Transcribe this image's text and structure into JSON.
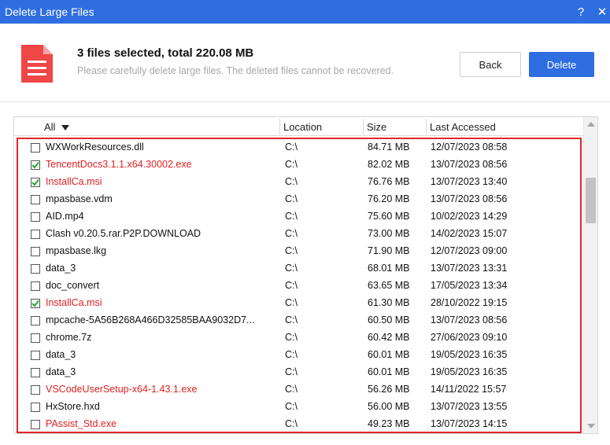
{
  "window": {
    "title": "Delete Large Files",
    "help_label": "?",
    "close_label": "✕"
  },
  "colors": {
    "accent": "#2f6ee0",
    "danger": "#e0262b",
    "file_icon": "#ef4646"
  },
  "header": {
    "summary": "3 files selected, total 220.08 MB",
    "warning": "Please carefully delete large files. The deleted files cannot be recovered.",
    "back_label": "Back",
    "delete_label": "Delete"
  },
  "table": {
    "headers": {
      "all": "All",
      "location": "Location",
      "size": "Size",
      "accessed": "Last Accessed"
    },
    "rows": [
      {
        "name": "WXWorkResources.dll",
        "location": "C:\\",
        "size": "84.71 MB",
        "accessed": "12/07/2023 08:58",
        "checked": false,
        "highlight": false
      },
      {
        "name": "TencentDocs3.1.1.x64.30002.exe",
        "location": "C:\\",
        "size": "82.02 MB",
        "accessed": "13/07/2023 08:56",
        "checked": true,
        "highlight": true
      },
      {
        "name": "InstallCa.msi",
        "location": "C:\\",
        "size": "76.76 MB",
        "accessed": "13/07/2023 13:40",
        "checked": true,
        "highlight": true
      },
      {
        "name": "mpasbase.vdm",
        "location": "C:\\",
        "size": "76.20 MB",
        "accessed": "13/07/2023 08:56",
        "checked": false,
        "highlight": false
      },
      {
        "name": "AID.mp4",
        "location": "C:\\",
        "size": "75.60 MB",
        "accessed": "10/02/2023 14:29",
        "checked": false,
        "highlight": false
      },
      {
        "name": "Clash v0.20.5.rar.P2P.DOWNLOAD",
        "location": "C:\\",
        "size": "73.00 MB",
        "accessed": "14/02/2023 15:07",
        "checked": false,
        "highlight": false
      },
      {
        "name": "mpasbase.lkg",
        "location": "C:\\",
        "size": "71.90 MB",
        "accessed": "12/07/2023 09:00",
        "checked": false,
        "highlight": false
      },
      {
        "name": "data_3",
        "location": "C:\\",
        "size": "68.01 MB",
        "accessed": "13/07/2023 13:31",
        "checked": false,
        "highlight": false
      },
      {
        "name": "doc_convert",
        "location": "C:\\",
        "size": "63.65 MB",
        "accessed": "17/05/2023 13:34",
        "checked": false,
        "highlight": false
      },
      {
        "name": "InstallCa.msi",
        "location": "C:\\",
        "size": "61.30 MB",
        "accessed": "28/10/2022 19:15",
        "checked": true,
        "highlight": true
      },
      {
        "name": "mpcache-5A56B268A466D32585BAA9032D7...",
        "location": "C:\\",
        "size": "60.50 MB",
        "accessed": "13/07/2023 08:56",
        "checked": false,
        "highlight": false
      },
      {
        "name": "chrome.7z",
        "location": "C:\\",
        "size": "60.42 MB",
        "accessed": "27/06/2023 09:10",
        "checked": false,
        "highlight": false
      },
      {
        "name": "data_3",
        "location": "C:\\",
        "size": "60.01 MB",
        "accessed": "19/05/2023 16:35",
        "checked": false,
        "highlight": false
      },
      {
        "name": "data_3",
        "location": "C:\\",
        "size": "60.01 MB",
        "accessed": "19/05/2023 16:35",
        "checked": false,
        "highlight": false
      },
      {
        "name": "VSCodeUserSetup-x64-1.43.1.exe",
        "location": "C:\\",
        "size": "56.26 MB",
        "accessed": "14/11/2022 15:57",
        "checked": false,
        "highlight": true
      },
      {
        "name": "HxStore.hxd",
        "location": "C:\\",
        "size": "56.00 MB",
        "accessed": "13/07/2023 13:55",
        "checked": false,
        "highlight": false
      },
      {
        "name": "PAssist_Std.exe",
        "location": "C:\\",
        "size": "49.23 MB",
        "accessed": "13/07/2023 14:15",
        "checked": false,
        "highlight": true
      }
    ]
  },
  "icons": {
    "file": "document-icon",
    "sort": "caret-down-icon",
    "check": "checkmark-icon"
  }
}
